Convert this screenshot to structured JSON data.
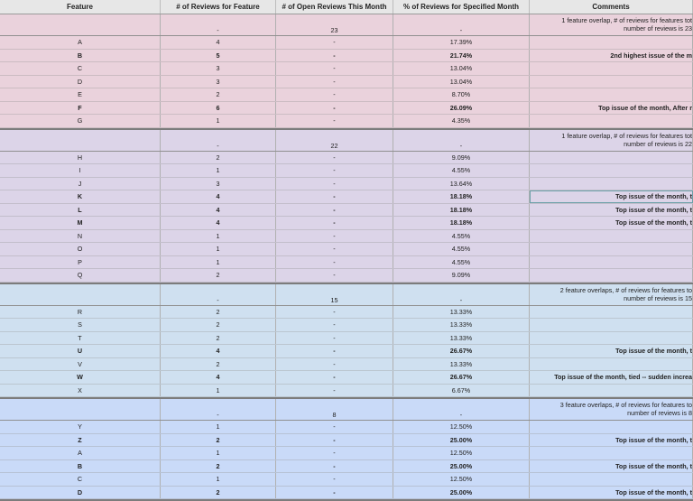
{
  "headers": [
    "Feature",
    "# of Reviews for Feature",
    "# of Open Reviews This Month",
    "% of Reviews for Specified Month",
    "Comments"
  ],
  "groups": [
    {
      "total": "23",
      "comment_lines": [
        "1 feature overlap, # of reviews for features tot",
        "number of reviews is 23"
      ],
      "rows": [
        {
          "f": "A",
          "n": "4",
          "o": "-",
          "p": "17.39%",
          "c": "",
          "b": false
        },
        {
          "f": "B",
          "n": "5",
          "o": "-",
          "p": "21.74%",
          "c": "2nd highest issue of the m",
          "b": true
        },
        {
          "f": "C",
          "n": "3",
          "o": "-",
          "p": "13.04%",
          "c": "",
          "b": false
        },
        {
          "f": "D",
          "n": "3",
          "o": "-",
          "p": "13.04%",
          "c": "",
          "b": false
        },
        {
          "f": "E",
          "n": "2",
          "o": "-",
          "p": "8.70%",
          "c": "",
          "b": false
        },
        {
          "f": "F",
          "n": "6",
          "o": "-",
          "p": "26.09%",
          "c": "Top issue of the month, After r",
          "b": true
        },
        {
          "f": "G",
          "n": "1",
          "o": "-",
          "p": "4.35%",
          "c": "",
          "b": false
        }
      ]
    },
    {
      "total": "22",
      "comment_lines": [
        "1 feature overlap, # of reviews for features tot",
        "number of reviews is 22"
      ],
      "rows": [
        {
          "f": "H",
          "n": "2",
          "o": "-",
          "p": "9.09%",
          "c": "",
          "b": false
        },
        {
          "f": "I",
          "n": "1",
          "o": "-",
          "p": "4.55%",
          "c": "",
          "b": false
        },
        {
          "f": "J",
          "n": "3",
          "o": "-",
          "p": "13.64%",
          "c": "",
          "b": false
        },
        {
          "f": "K",
          "n": "4",
          "o": "-",
          "p": "18.18%",
          "c": "Top issue of the month, t",
          "b": true,
          "sel": true
        },
        {
          "f": "L",
          "n": "4",
          "o": "-",
          "p": "18.18%",
          "c": "Top issue of the month, t",
          "b": true
        },
        {
          "f": "M",
          "n": "4",
          "o": "-",
          "p": "18.18%",
          "c": "Top issue of the month, t",
          "b": true
        },
        {
          "f": "N",
          "n": "1",
          "o": "-",
          "p": "4.55%",
          "c": "",
          "b": false
        },
        {
          "f": "O",
          "n": "1",
          "o": "-",
          "p": "4.55%",
          "c": "",
          "b": false
        },
        {
          "f": "P",
          "n": "1",
          "o": "-",
          "p": "4.55%",
          "c": "",
          "b": false
        },
        {
          "f": "Q",
          "n": "2",
          "o": "-",
          "p": "9.09%",
          "c": "",
          "b": false
        }
      ]
    },
    {
      "total": "15",
      "comment_lines": [
        "2 feature overlaps, # of reviews for features to",
        "number of reviews is 15"
      ],
      "rows": [
        {
          "f": "R",
          "n": "2",
          "o": "-",
          "p": "13.33%",
          "c": "",
          "b": false
        },
        {
          "f": "S",
          "n": "2",
          "o": "-",
          "p": "13.33%",
          "c": "",
          "b": false
        },
        {
          "f": "T",
          "n": "2",
          "o": "-",
          "p": "13.33%",
          "c": "",
          "b": false
        },
        {
          "f": "U",
          "n": "4",
          "o": "-",
          "p": "26.67%",
          "c": "Top issue of the month, t",
          "b": true
        },
        {
          "f": "V",
          "n": "2",
          "o": "-",
          "p": "13.33%",
          "c": "",
          "b": false
        },
        {
          "f": "W",
          "n": "4",
          "o": "-",
          "p": "26.67%",
          "c": "Top issue of the month, tied -- sudden increa",
          "b": true
        },
        {
          "f": "X",
          "n": "1",
          "o": "-",
          "p": "6.67%",
          "c": "",
          "b": false
        }
      ]
    },
    {
      "total": "8",
      "comment_lines": [
        "3 feature overlaps, # of reviews for features to",
        "number of reviews is 8"
      ],
      "rows": [
        {
          "f": "Y",
          "n": "1",
          "o": "-",
          "p": "12.50%",
          "c": "",
          "b": false
        },
        {
          "f": "Z",
          "n": "2",
          "o": "-",
          "p": "25.00%",
          "c": "Top issue of the month, t",
          "b": true
        },
        {
          "f": "A",
          "n": "1",
          "o": "-",
          "p": "12.50%",
          "c": "",
          "b": false
        },
        {
          "f": "B",
          "n": "2",
          "o": "-",
          "p": "25.00%",
          "c": "Top issue of the month, t",
          "b": true
        },
        {
          "f": "C",
          "n": "1",
          "o": "-",
          "p": "12.50%",
          "c": "",
          "b": false
        },
        {
          "f": "D",
          "n": "2",
          "o": "-",
          "p": "25.00%",
          "c": "Top issue of the month, t",
          "b": true
        }
      ]
    }
  ]
}
